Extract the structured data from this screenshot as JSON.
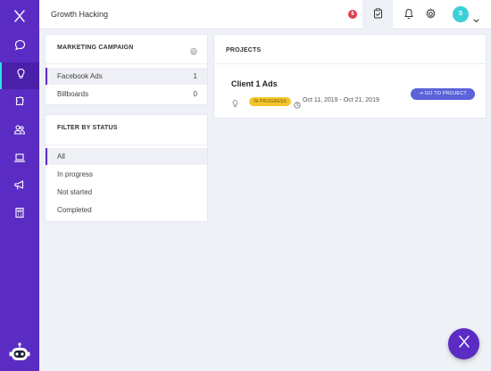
{
  "topbar": {
    "title": "Growth Hacking",
    "notification_count": "6",
    "avatar_initial": "S"
  },
  "sidebar": {
    "items": [
      "chat-icon",
      "lightbulb-icon",
      "puzzle-icon",
      "people-icon",
      "laptop-icon",
      "megaphone-icon",
      "calculator-icon"
    ],
    "active_index": 1,
    "accent_color": "#5b2cc4",
    "active_marker_color": "#2de0ea"
  },
  "marketing_campaign": {
    "title": "MARKETING CAMPAIGN",
    "items": [
      {
        "label": "Facebook Ads",
        "count": "1"
      },
      {
        "label": "Billboards",
        "count": "0"
      }
    ]
  },
  "filter_by_status": {
    "title": "FILTER BY STATUS",
    "items": [
      {
        "label": "All"
      },
      {
        "label": "In progress"
      },
      {
        "label": "Not started"
      },
      {
        "label": "Completed"
      }
    ]
  },
  "projects": {
    "title": "PROJECTS",
    "items": [
      {
        "name": "Client 1 Ads",
        "status": "IN PROGRESS",
        "date_range": "Oct 11, 2019 - Oct 21, 2019",
        "button_label": "GO TO PROJECT"
      }
    ]
  },
  "colors": {
    "status_in_progress": "#f3c62e",
    "button": "#5b63d9",
    "badge": "#e0404f",
    "avatar": "#3ccfd8"
  }
}
